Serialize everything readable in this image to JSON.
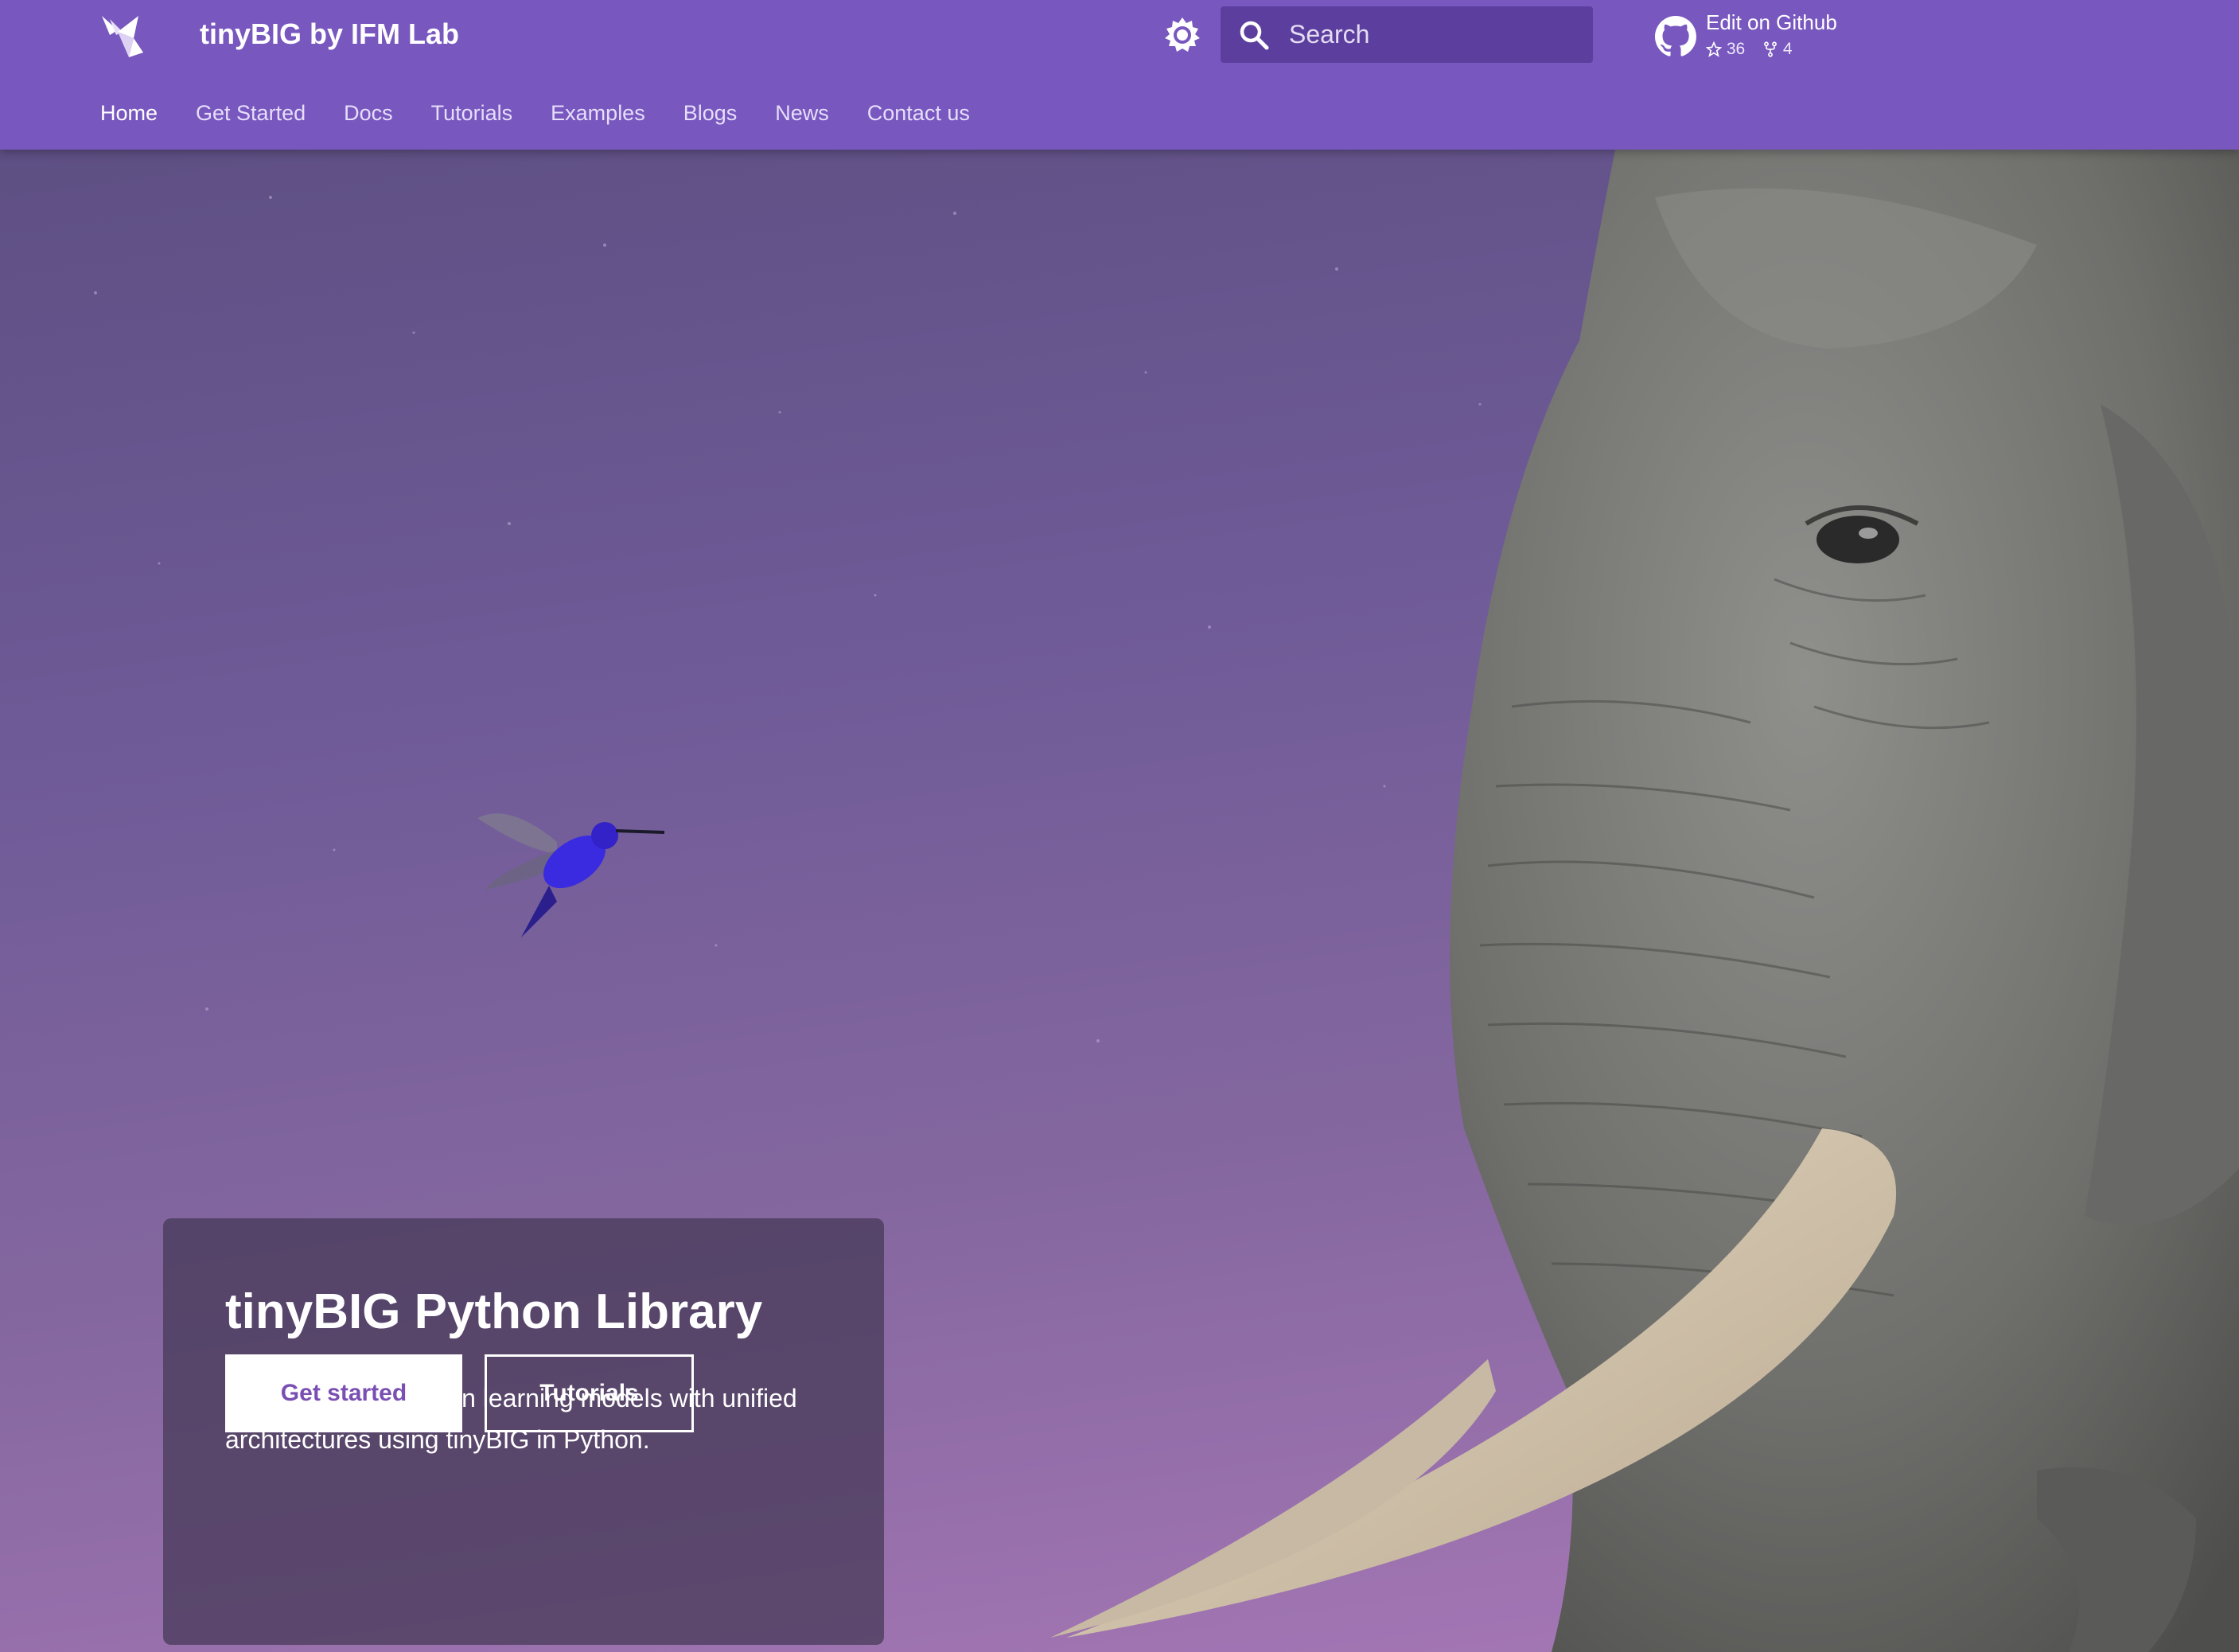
{
  "header": {
    "logo_icon": "origami-bird-icon",
    "site_title": "tinyBIG by IFM Lab",
    "theme_toggle_icon": "brightness-icon",
    "search": {
      "placeholder": "Search",
      "value": "",
      "icon": "search-icon"
    },
    "repo": {
      "icon": "github-icon",
      "label": "Edit on Github",
      "stars": "36",
      "forks": "4"
    },
    "tabs": [
      {
        "label": "Home",
        "active": true
      },
      {
        "label": "Get Started"
      },
      {
        "label": "Docs"
      },
      {
        "label": "Tutorials"
      },
      {
        "label": "Examples"
      },
      {
        "label": "Blogs"
      },
      {
        "label": "News"
      },
      {
        "label": "Contact us"
      }
    ]
  },
  "hero": {
    "title": "tinyBIG Python Library",
    "subtitle": "Building deep function learning models with unified architectures using tinyBIG in Python.",
    "primary_button": "Get started",
    "secondary_button": "Tutorials"
  },
  "colors": {
    "header_bg": "#7857bf",
    "search_bg": "#5c3e9e",
    "primary_button_text": "#7a4fb3",
    "card_bg": "rgba(68,56,84,0.72)"
  }
}
